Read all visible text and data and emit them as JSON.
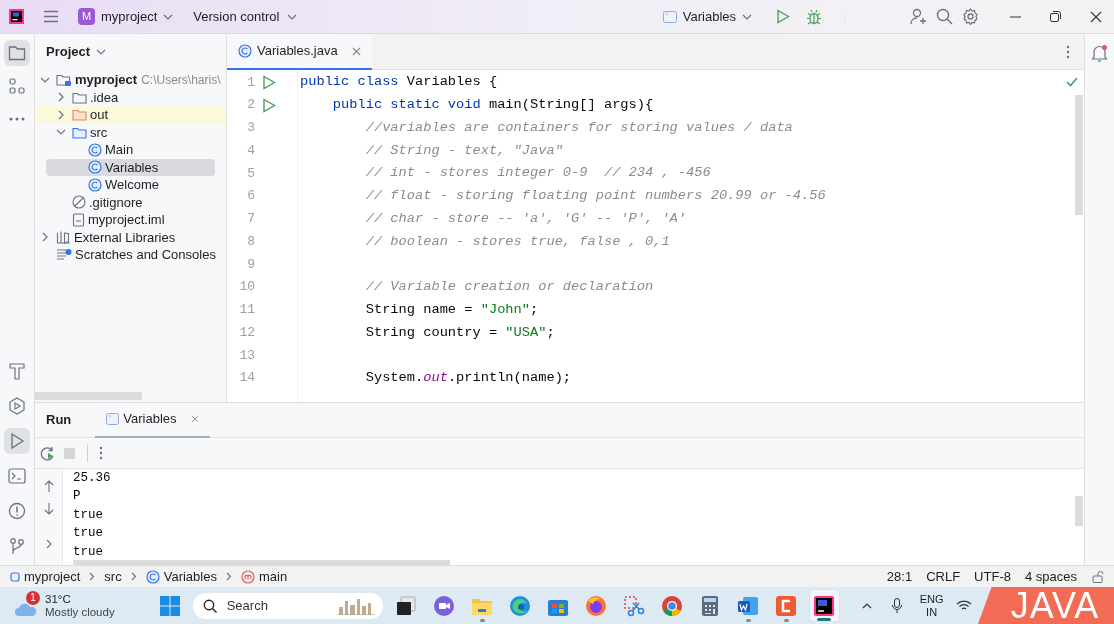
{
  "title_bar": {
    "project_initial": "M",
    "project": "myproject",
    "vcs": "Version control",
    "run_config": "Variables"
  },
  "left_toolbar": {
    "top": [
      {
        "kind": "project",
        "selected": true
      },
      {
        "kind": "structure",
        "selected": false
      },
      {
        "kind": "more",
        "selected": false
      }
    ],
    "bottom": [
      {
        "kind": "build",
        "selected": false
      },
      {
        "kind": "services",
        "selected": false
      },
      {
        "kind": "run",
        "selected": true
      },
      {
        "kind": "terminal",
        "selected": false
      },
      {
        "kind": "problems",
        "selected": false
      },
      {
        "kind": "git",
        "selected": false
      }
    ]
  },
  "project_panel": {
    "title": "Project",
    "tree": [
      {
        "label": "myproject",
        "kind": "module",
        "note": "C:\\Users\\haris\\",
        "expanded": true,
        "selected": false,
        "highlighted": false,
        "children": [
          {
            "label": ".idea",
            "kind": "folder",
            "expanded": false,
            "selected": false,
            "highlighted": false
          },
          {
            "label": "out",
            "kind": "excluded-folder",
            "expanded": false,
            "selected": false,
            "highlighted": true
          },
          {
            "label": "src",
            "kind": "source-folder",
            "expanded": true,
            "selected": false,
            "highlighted": false,
            "children": [
              {
                "label": "Main",
                "kind": "class",
                "selected": false,
                "highlighted": false
              },
              {
                "label": "Variables",
                "kind": "class",
                "selected": true,
                "highlighted": false
              },
              {
                "label": "Welcome",
                "kind": "class",
                "selected": false,
                "highlighted": false
              }
            ]
          },
          {
            "label": ".gitignore",
            "kind": "ignore-file",
            "selected": false,
            "highlighted": false
          },
          {
            "label": "myproject.iml",
            "kind": "file",
            "selected": false,
            "highlighted": false
          }
        ]
      },
      {
        "label": "External Libraries",
        "kind": "libraries",
        "expanded": false,
        "selected": false,
        "highlighted": false
      },
      {
        "label": "Scratches and Consoles",
        "kind": "scratches",
        "selected": false,
        "highlighted": false
      }
    ]
  },
  "editor": {
    "tabs": [
      {
        "label": "Variables.java",
        "selected": true
      }
    ],
    "lines": [
      {
        "number": "1",
        "runnable": true,
        "tokens": [
          {
            "kind": "keyword",
            "text": "public class"
          },
          {
            "kind": "plain",
            "text": " Variables {"
          }
        ]
      },
      {
        "number": "2",
        "runnable": true,
        "tokens": [
          {
            "kind": "keyword",
            "text": "    public static void"
          },
          {
            "kind": "plain",
            "text": " main(String[] args){"
          }
        ]
      },
      {
        "number": "3",
        "runnable": false,
        "tokens": [
          {
            "kind": "comment",
            "text": "        //variables are containers for storing values / data"
          }
        ]
      },
      {
        "number": "4",
        "runnable": false,
        "tokens": [
          {
            "kind": "comment",
            "text": "        // String - text, \"Java\""
          }
        ]
      },
      {
        "number": "5",
        "runnable": false,
        "tokens": [
          {
            "kind": "comment",
            "text": "        // int - stores integer 0-9  // 234 , -456"
          }
        ]
      },
      {
        "number": "6",
        "runnable": false,
        "tokens": [
          {
            "kind": "comment",
            "text": "        // float - storing floating point numbers 20.99 or -4.56"
          }
        ]
      },
      {
        "number": "7",
        "runnable": false,
        "tokens": [
          {
            "kind": "comment",
            "text": "        // char - store -- 'a', 'G' -- 'P', 'A'"
          }
        ]
      },
      {
        "number": "8",
        "runnable": false,
        "tokens": [
          {
            "kind": "comment",
            "text": "        // boolean - stores true, false , 0,1"
          }
        ]
      },
      {
        "number": "9",
        "runnable": false
      },
      {
        "number": "10",
        "runnable": false,
        "tokens": [
          {
            "kind": "comment",
            "text": "        // Variable creation or declaration"
          }
        ]
      },
      {
        "number": "11",
        "runnable": false,
        "tokens": [
          {
            "kind": "plain",
            "text": "        String name = "
          },
          {
            "kind": "string",
            "text": "\"John\""
          },
          {
            "kind": "plain",
            "text": ";"
          }
        ]
      },
      {
        "number": "12",
        "runnable": false,
        "tokens": [
          {
            "kind": "plain",
            "text": "        String country = "
          },
          {
            "kind": "string",
            "text": "\"USA\""
          },
          {
            "kind": "plain",
            "text": ";"
          }
        ]
      },
      {
        "number": "13",
        "runnable": false
      },
      {
        "number": "14",
        "runnable": false,
        "tokens": [
          {
            "kind": "plain",
            "text": "        System."
          },
          {
            "kind": "field",
            "text": "out"
          },
          {
            "kind": "plain",
            "text": ".println(name);"
          }
        ]
      }
    ]
  },
  "run_panel": {
    "title": "Run",
    "tabs": [
      {
        "label": "Variables",
        "selected": true
      }
    ],
    "output": [
      "25.36",
      "P",
      "true",
      "true",
      "true"
    ]
  },
  "status_bar": {
    "breadcrumbs": [
      {
        "kind": "module",
        "label": "myproject"
      },
      {
        "kind": "folder",
        "label": "src"
      },
      {
        "kind": "class",
        "label": "Variables"
      },
      {
        "kind": "method",
        "label": "main"
      }
    ],
    "position": "28:1",
    "line_separator": "CRLF",
    "encoding": "UTF-8",
    "indent": "4 spaces"
  },
  "taskbar": {
    "weather": {
      "badge": "1",
      "temperature": "31°C",
      "condition": "Mostly cloudy"
    },
    "search_label": "Search",
    "apps": [
      {
        "kind": "task-view",
        "active": false,
        "running": false
      },
      {
        "kind": "chat",
        "active": false,
        "running": false
      },
      {
        "kind": "files",
        "active": false,
        "running": true
      },
      {
        "kind": "edge",
        "active": false,
        "running": false
      },
      {
        "kind": "store",
        "active": false,
        "running": false
      },
      {
        "kind": "firefox",
        "active": false,
        "running": false
      },
      {
        "kind": "snip",
        "active": false,
        "running": false
      },
      {
        "kind": "chrome",
        "active": false,
        "running": false
      },
      {
        "kind": "calculator",
        "active": false,
        "running": false
      },
      {
        "kind": "word",
        "active": false,
        "running": true
      },
      {
        "kind": "recorder",
        "active": false,
        "running": true
      },
      {
        "kind": "ide",
        "active": true,
        "running": true
      }
    ],
    "language": [
      "ENG",
      "IN"
    ]
  },
  "overlay": {
    "text": "JAVA"
  }
}
